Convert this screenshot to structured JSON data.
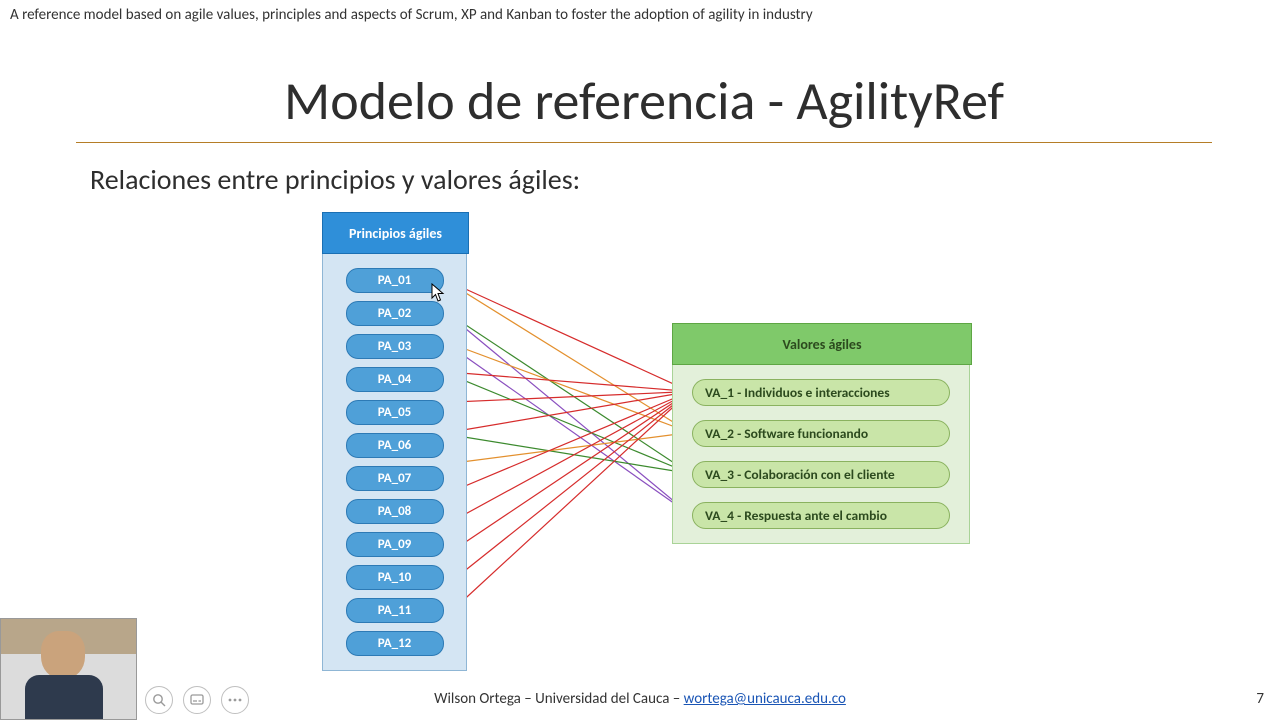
{
  "top_caption": "A reference model based on agile values, principles and aspects of Scrum, XP and Kanban to foster the adoption of agility in industry",
  "title": "Modelo de referencia - AgilityRef",
  "subtitle": "Relaciones entre principios y valores ágiles:",
  "principles": {
    "header": "Principios ágiles",
    "items": [
      "PA_01",
      "PA_02",
      "PA_03",
      "PA_04",
      "PA_05",
      "PA_06",
      "PA_07",
      "PA_08",
      "PA_09",
      "PA_10",
      "PA_11",
      "PA_12"
    ]
  },
  "values": {
    "header": "Valores ágiles",
    "items": [
      "VA_1 - Individuos e interacciones",
      "VA_2 - Software funcionando",
      "VA_3 - Colaboración con el cliente",
      "VA_4 - Respuesta ante el cambio"
    ]
  },
  "connections": [
    {
      "from": 0,
      "to": 0,
      "color": "red"
    },
    {
      "from": 0,
      "to": 1,
      "color": "orange"
    },
    {
      "from": 1,
      "to": 2,
      "color": "green"
    },
    {
      "from": 1,
      "to": 3,
      "color": "purple"
    },
    {
      "from": 2,
      "to": 1,
      "color": "orange"
    },
    {
      "from": 2,
      "to": 3,
      "color": "purple"
    },
    {
      "from": 3,
      "to": 0,
      "color": "red"
    },
    {
      "from": 3,
      "to": 2,
      "color": "green"
    },
    {
      "from": 4,
      "to": 0,
      "color": "red"
    },
    {
      "from": 5,
      "to": 0,
      "color": "red"
    },
    {
      "from": 5,
      "to": 2,
      "color": "green"
    },
    {
      "from": 6,
      "to": 1,
      "color": "orange"
    },
    {
      "from": 7,
      "to": 0,
      "color": "red"
    },
    {
      "from": 8,
      "to": 0,
      "color": "red"
    },
    {
      "from": 9,
      "to": 0,
      "color": "red"
    },
    {
      "from": 10,
      "to": 0,
      "color": "red"
    },
    {
      "from": 11,
      "to": 0,
      "color": "red"
    }
  ],
  "connection_colors": {
    "red": "#d62c2c",
    "orange": "#e3902e",
    "green": "#3c8a2e",
    "purple": "#8a4fbf"
  },
  "footer": {
    "author_text": "Wilson Ortega – Universidad del Cauca – ",
    "email": "wortega@unicauca.edu.co"
  },
  "slide_number": "7"
}
